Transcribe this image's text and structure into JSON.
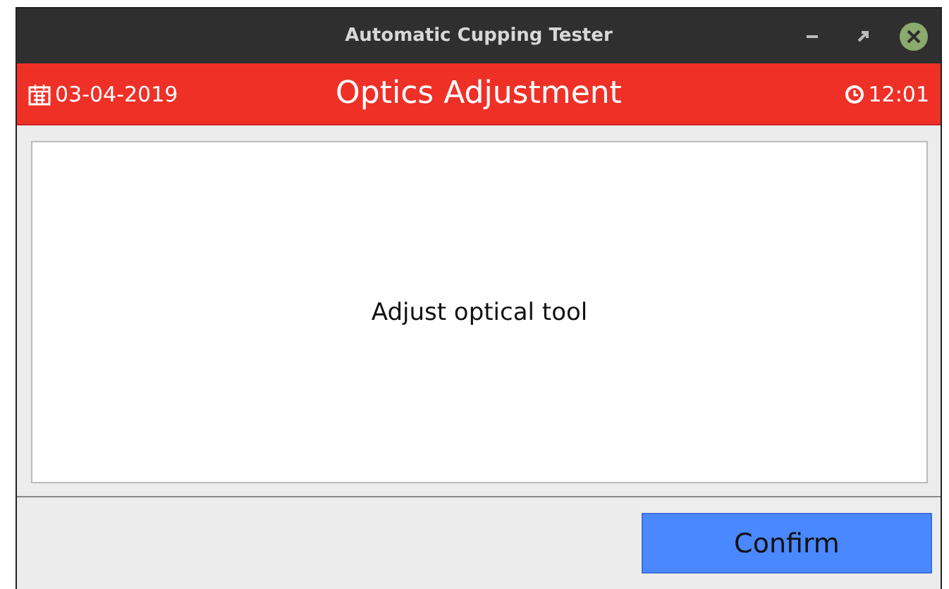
{
  "window": {
    "title": "Automatic Cupping Tester"
  },
  "header": {
    "date": "03-04-2019",
    "title": "Optics Adjustment",
    "time": "12:01"
  },
  "message": "Adjust optical tool",
  "buttons": [
    "Confirm"
  ]
}
